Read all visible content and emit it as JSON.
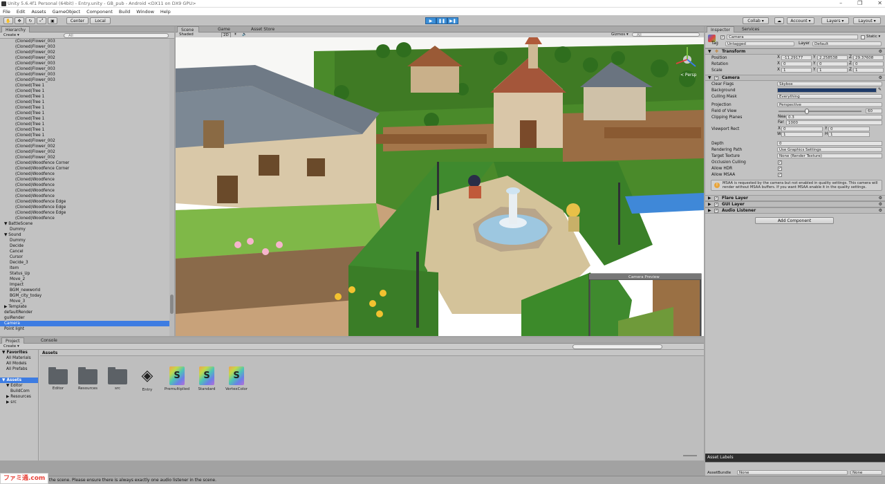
{
  "window": {
    "title": "Unity 5.6.4f1 Personal (64bit) - Entry.unity - GB_pub - Android <DX11 on DX9 GPU>"
  },
  "menu": [
    "File",
    "Edit",
    "Assets",
    "GameObject",
    "Component",
    "Build",
    "Window",
    "Help"
  ],
  "toolbar": {
    "pivot": "Center",
    "space": "Local",
    "collab": "Collab ▾",
    "account": "Account ▾",
    "layers": "Layers ▾",
    "layout": "Layout ▾"
  },
  "hierarchy": {
    "tab": "Hierarchy",
    "create": "Create ▾",
    "search_placeholder": "All",
    "items": [
      {
        "label": "(Cloned)Flower_003",
        "indent": 2
      },
      {
        "label": "(Cloned)Flower_003",
        "indent": 2
      },
      {
        "label": "(Cloned)Flower_002",
        "indent": 2
      },
      {
        "label": "(Cloned)Flower_002",
        "indent": 2
      },
      {
        "label": "(Cloned)Flower_003",
        "indent": 2
      },
      {
        "label": "(Cloned)Flower_003",
        "indent": 2
      },
      {
        "label": "(Cloned)Flower_003",
        "indent": 2
      },
      {
        "label": "(Cloned)Flower_003",
        "indent": 2
      },
      {
        "label": "(Cloned)Tree 1",
        "indent": 2
      },
      {
        "label": "(Cloned)Tree 1",
        "indent": 2
      },
      {
        "label": "(Cloned)Tree 1",
        "indent": 2
      },
      {
        "label": "(Cloned)Tree 1",
        "indent": 2
      },
      {
        "label": "(Cloned)Tree 1",
        "indent": 2
      },
      {
        "label": "(Cloned)Tree 1",
        "indent": 2
      },
      {
        "label": "(Cloned)Tree 1",
        "indent": 2
      },
      {
        "label": "(Cloned)Tree 1",
        "indent": 2
      },
      {
        "label": "(Cloned)Tree 1",
        "indent": 2
      },
      {
        "label": "(Cloned)Tree 1",
        "indent": 2
      },
      {
        "label": "(Cloned)Flower_002",
        "indent": 2
      },
      {
        "label": "(Cloned)Flower_002",
        "indent": 2
      },
      {
        "label": "(Cloned)Flower_002",
        "indent": 2
      },
      {
        "label": "(Cloned)Flower_002",
        "indent": 2
      },
      {
        "label": "(Cloned)Woodfence Corner",
        "indent": 2
      },
      {
        "label": "(Cloned)Woodfence Corner",
        "indent": 2
      },
      {
        "label": "(Cloned)Woodfence",
        "indent": 2
      },
      {
        "label": "(Cloned)Woodfence",
        "indent": 2
      },
      {
        "label": "(Cloned)Woodfence",
        "indent": 2
      },
      {
        "label": "(Cloned)Woodfence",
        "indent": 2
      },
      {
        "label": "(Cloned)Woodfence",
        "indent": 2
      },
      {
        "label": "(Cloned)Woodfence Edge",
        "indent": 2
      },
      {
        "label": "(Cloned)Woodfence Edge",
        "indent": 2
      },
      {
        "label": "(Cloned)Woodfence Edge",
        "indent": 2
      },
      {
        "label": "(Cloned)Woodfence",
        "indent": 2
      },
      {
        "label": "▼ BattleScene",
        "indent": 0
      },
      {
        "label": "Dummy",
        "indent": 1
      },
      {
        "label": "▼ Sound",
        "indent": 0
      },
      {
        "label": "Dummy",
        "indent": 1
      },
      {
        "label": "Decide",
        "indent": 1
      },
      {
        "label": "Cancel",
        "indent": 1
      },
      {
        "label": "Cursor",
        "indent": 1
      },
      {
        "label": "Decide_3",
        "indent": 1
      },
      {
        "label": "Item",
        "indent": 1
      },
      {
        "label": "Status_Up",
        "indent": 1
      },
      {
        "label": "Move_2",
        "indent": 1
      },
      {
        "label": "Impact",
        "indent": 1
      },
      {
        "label": "BGM_newworld",
        "indent": 1
      },
      {
        "label": "BGM_city_today",
        "indent": 1
      },
      {
        "label": "Move_3",
        "indent": 1
      },
      {
        "label": "▶ Template",
        "indent": 0
      },
      {
        "label": "defaultRender",
        "indent": 0
      },
      {
        "label": "guiRender",
        "indent": 0
      },
      {
        "label": "Camera",
        "indent": 0,
        "selected": true
      },
      {
        "label": "Point light",
        "indent": 0
      }
    ]
  },
  "scene": {
    "tabs": [
      "Scene",
      "Game",
      "Asset Store"
    ],
    "shading": "Shaded",
    "mode": "2D",
    "gizmos": "Gizmos ▾",
    "search_placeholder": "All",
    "persp_label": "< Persp",
    "camera_preview": "Camera Preview"
  },
  "inspector": {
    "tabs": [
      "Inspector",
      "Services"
    ],
    "object_name": "Camera",
    "static_label": "Static ▾",
    "tag_label": "Tag",
    "tag_value": "Untagged",
    "layer_label": "Layer",
    "layer_value": "Default",
    "transform": {
      "title": "Transform",
      "rows": [
        {
          "label": "Position",
          "x": "-11.29177",
          "y": "2.258538",
          "z": "29.37608"
        },
        {
          "label": "Rotation",
          "x": "0",
          "y": "0",
          "z": "0"
        },
        {
          "label": "Scale",
          "x": "1",
          "y": "1",
          "z": "1"
        }
      ]
    },
    "camera": {
      "title": "Camera",
      "clear_flags": {
        "label": "Clear Flags",
        "value": "Skybox"
      },
      "background": {
        "label": "Background",
        "color": "#1e3a68"
      },
      "culling_mask": {
        "label": "Culling Mask",
        "value": "Everything"
      },
      "projection": {
        "label": "Projection",
        "value": "Perspective"
      },
      "fov": {
        "label": "Field of View",
        "value": "60",
        "fraction": 0.33
      },
      "clipping": {
        "label": "Clipping Planes",
        "near_label": "Near",
        "near": "0.3",
        "far_label": "Far",
        "far": "1000"
      },
      "viewport": {
        "label": "Viewport Rect",
        "x": "0",
        "y": "0",
        "w": "1",
        "h": "1"
      },
      "depth": {
        "label": "Depth",
        "value": "0"
      },
      "rendering_path": {
        "label": "Rendering Path",
        "value": "Use Graphics Settings"
      },
      "target_texture": {
        "label": "Target Texture",
        "value": "None (Render Texture)"
      },
      "occlusion": {
        "label": "Occlusion Culling"
      },
      "hdr": {
        "label": "Allow HDR"
      },
      "msaa": {
        "label": "Allow MSAA"
      },
      "warning": "MSAA is requested by the camera but not enabled in quality settings. This camera will render without MSAA buffers. If you want MSAA enable it in the quality settings."
    },
    "components": [
      "Flare Layer",
      "GUI Layer",
      "Audio Listener"
    ],
    "add_component": "Add Component",
    "asset_labels": "Asset Labels",
    "asset_bundle": {
      "label": "AssetBundle",
      "value": "None",
      "variant": "None"
    }
  },
  "project": {
    "tabs": [
      "Project",
      "Console"
    ],
    "create": "Create ▾",
    "tree": [
      {
        "label": "▼ Favorites",
        "indent": 0,
        "bold": true
      },
      {
        "label": "All Materials",
        "indent": 1
      },
      {
        "label": "All Models",
        "indent": 1
      },
      {
        "label": "All Prefabs",
        "indent": 1
      },
      {
        "label": "",
        "indent": 0
      },
      {
        "label": "▼ Assets",
        "indent": 0,
        "selected": true,
        "bold": true
      },
      {
        "label": "▼ Editor",
        "indent": 1
      },
      {
        "label": "BuildCom",
        "indent": 2
      },
      {
        "label": "▶ Resources",
        "indent": 1
      },
      {
        "label": "▶ src",
        "indent": 1
      }
    ],
    "breadcrumb": "Assets",
    "assets": [
      {
        "name": "Editor",
        "kind": "folder"
      },
      {
        "name": "Resources",
        "kind": "folder"
      },
      {
        "name": "src",
        "kind": "folder"
      },
      {
        "name": "Entry",
        "kind": "unity"
      },
      {
        "name": "Premultiplied",
        "kind": "shader"
      },
      {
        "name": "Standard",
        "kind": "shader"
      },
      {
        "name": "VertexColor",
        "kind": "shader"
      }
    ]
  },
  "status": {
    "message": "rs in the scene. Please ensure there is always exactly one audio listener in the scene.",
    "watermark": "ファミ通.com"
  }
}
